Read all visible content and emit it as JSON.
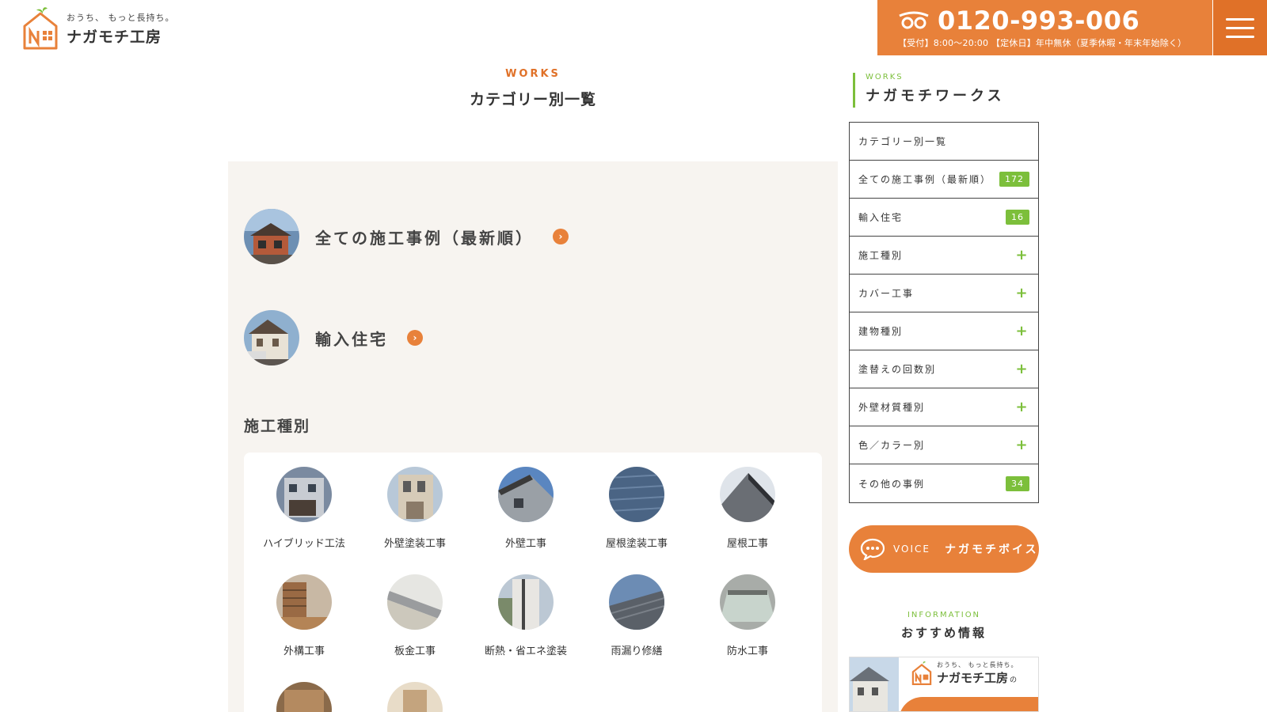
{
  "header": {
    "logo_tagline": "おうち、 もっと長持ち。",
    "logo_name": "ナガモチ工房",
    "tel_number": "0120-993-006",
    "tel_hours": "【受付】8:00〜20:00 【定休日】年中無休（夏季休暇・年末年始除く）"
  },
  "main": {
    "title_en": "WORKS",
    "title_ja": "カテゴリー別一覧",
    "links": [
      {
        "label": "全ての施工事例（最新順）"
      },
      {
        "label": "輸入住宅"
      }
    ],
    "section_title": "施工種別",
    "categories": [
      {
        "label": "ハイブリッド工法"
      },
      {
        "label": "外壁塗装工事"
      },
      {
        "label": "外壁工事"
      },
      {
        "label": "屋根塗装工事"
      },
      {
        "label": "屋根工事"
      },
      {
        "label": "外構工事"
      },
      {
        "label": "板金工事"
      },
      {
        "label": "断熱・省エネ塗装"
      },
      {
        "label": "雨漏り修繕"
      },
      {
        "label": "防水工事"
      }
    ]
  },
  "sidebar": {
    "title_en": "WORKS",
    "title_ja": "ナガモチワークス",
    "items": [
      {
        "label": "カテゴリー別一覧",
        "badge": null,
        "expand": false
      },
      {
        "label": "全ての施工事例（最新順）",
        "badge": "172",
        "expand": false
      },
      {
        "label": "輸入住宅",
        "badge": "16",
        "expand": false
      },
      {
        "label": "施工種別",
        "badge": null,
        "expand": true
      },
      {
        "label": "カバー工事",
        "badge": null,
        "expand": true
      },
      {
        "label": "建物種別",
        "badge": null,
        "expand": true
      },
      {
        "label": "塗替えの回数別",
        "badge": null,
        "expand": true
      },
      {
        "label": "外壁材質種別",
        "badge": null,
        "expand": true
      },
      {
        "label": "色／カラー別",
        "badge": null,
        "expand": true
      },
      {
        "label": "その他の事例",
        "badge": "34",
        "expand": false
      }
    ],
    "plus_symbol": "+",
    "voice_en": "VOICE",
    "voice_ja": "ナガモチボイス",
    "info_en": "INFORMATION",
    "info_ja": "おすすめ情報",
    "banner_tagline": "おうち、 もっと長持ち。",
    "banner_name": "ナガモチ工房",
    "banner_suffix": "の"
  },
  "colors": {
    "accent": "#e8813a",
    "accent_dark": "#e07128",
    "green": "#7cbf3b",
    "panel": "#f7f4f0"
  }
}
